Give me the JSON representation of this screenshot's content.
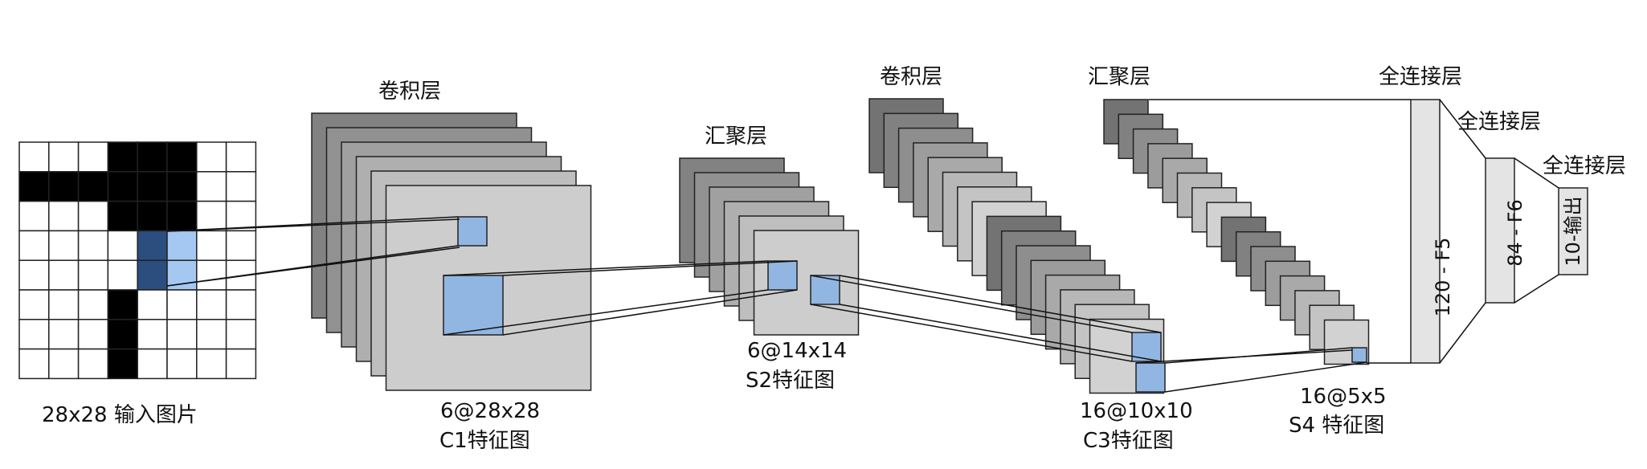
{
  "input": {
    "caption": "28x28 输入图片",
    "grid_rows": 8,
    "grid_cols": 8,
    "black_cells": [
      [
        0,
        3
      ],
      [
        0,
        4
      ],
      [
        0,
        5
      ],
      [
        1,
        0
      ],
      [
        1,
        1
      ],
      [
        1,
        2
      ],
      [
        1,
        3
      ],
      [
        1,
        4
      ],
      [
        1,
        5
      ],
      [
        2,
        3
      ],
      [
        2,
        4
      ],
      [
        2,
        5
      ],
      [
        5,
        3
      ],
      [
        6,
        3
      ],
      [
        7,
        3
      ]
    ],
    "receptive_field_dark": [
      [
        3,
        4
      ],
      [
        4,
        4
      ]
    ],
    "receptive_field_light": [
      [
        3,
        5
      ],
      [
        4,
        5
      ]
    ]
  },
  "layers": {
    "conv1": {
      "title": "卷积层",
      "caption_line1": "6@28x28",
      "caption_line2": "C1特征图",
      "maps": 6
    },
    "pool1": {
      "title": "汇聚层",
      "caption_line1": "6@14x14",
      "caption_line2": "S2特征图",
      "maps": 6
    },
    "conv2": {
      "title": "卷积层",
      "caption_line1": "16@10x10",
      "caption_line2": "C3特征图",
      "maps": 16
    },
    "pool2": {
      "title": "汇聚层",
      "caption_line1": "16@5x5",
      "caption_line2": "S4 特征图",
      "maps": 16
    },
    "fc5": {
      "title": "全连接层",
      "label": "120 - F5"
    },
    "fc6": {
      "title": "全连接层",
      "label": "84 - F6"
    },
    "out": {
      "title": "全连接层",
      "label": "10-输出"
    }
  },
  "colors": {
    "highlight_fill": "#92b6e2",
    "receptive_dark": "#2b4e7e",
    "receptive_light": "#a4c8f2",
    "fc_fill": "#e4e4e4",
    "stroke": "#222222"
  }
}
